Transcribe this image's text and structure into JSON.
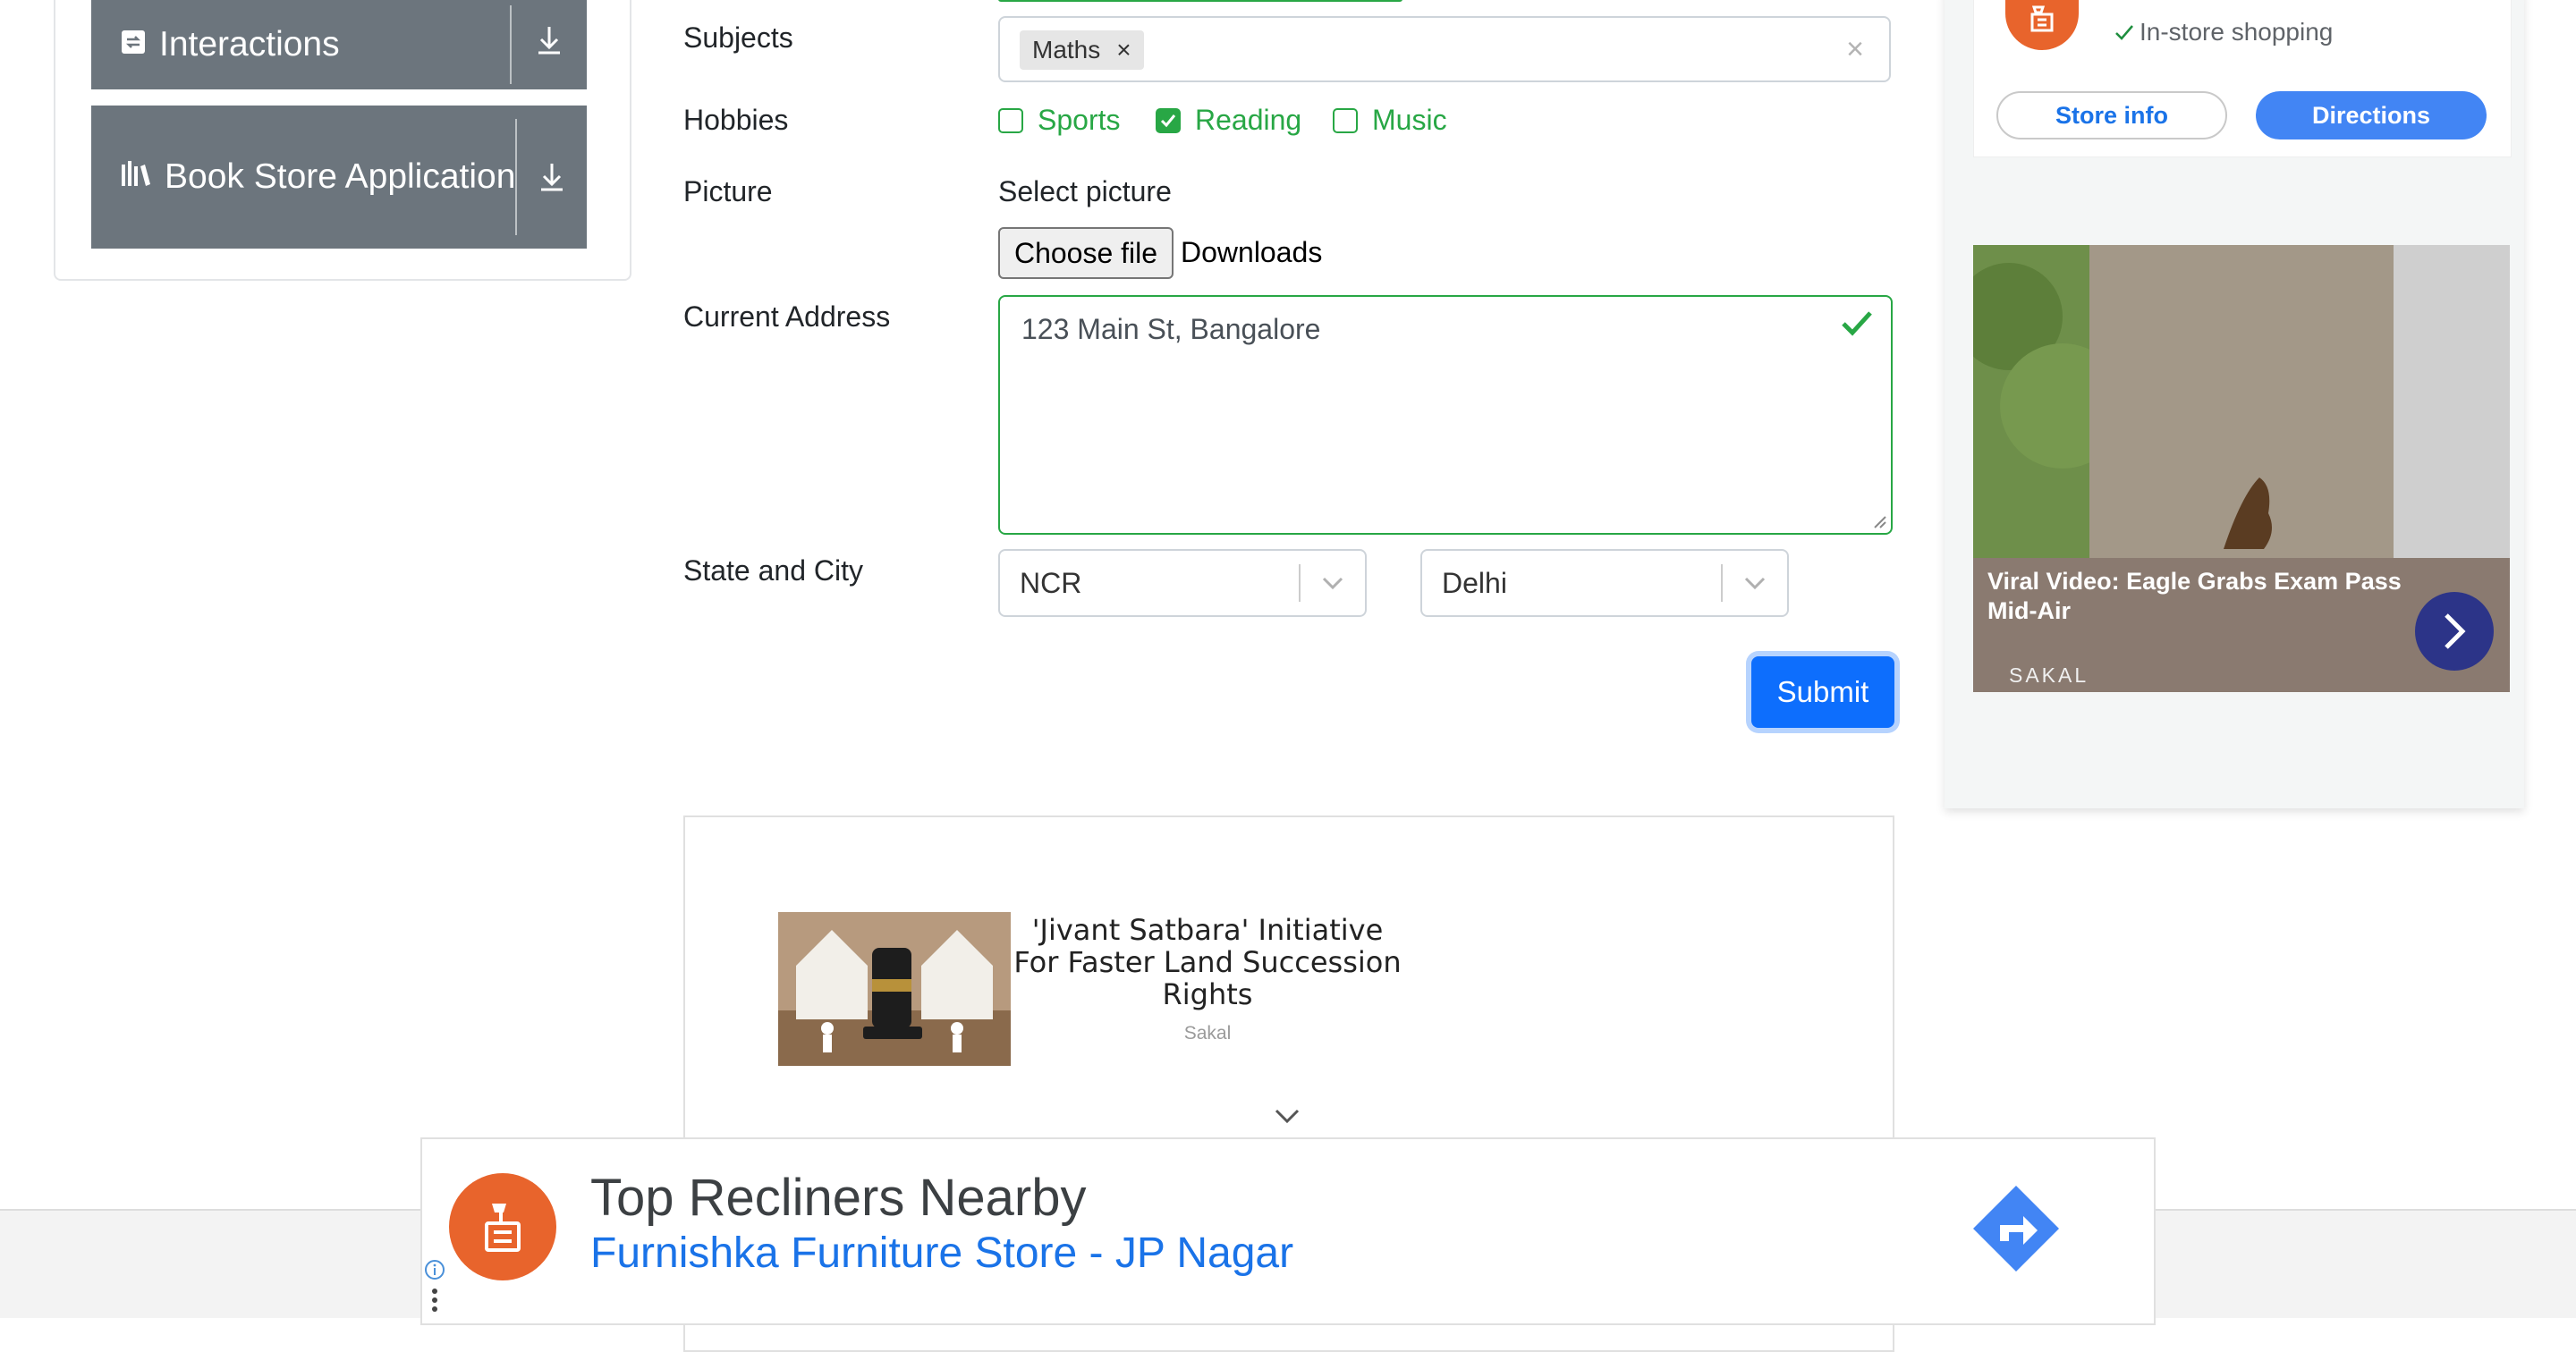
{
  "sidebar": {
    "items": [
      {
        "label": "Interactions"
      },
      {
        "label": "Book Store Application"
      }
    ]
  },
  "form": {
    "subjects_label": "Subjects",
    "subject_chip": "Maths",
    "chip_remove": "×",
    "clear_all": "×",
    "hobbies_label": "Hobbies",
    "hobbies": [
      {
        "label": "Sports",
        "checked": false
      },
      {
        "label": "Reading",
        "checked": true
      },
      {
        "label": "Music",
        "checked": false
      }
    ],
    "picture_label": "Picture",
    "select_picture": "Select picture",
    "choose_file": "Choose file",
    "file_name": "Downloads",
    "address_label": "Current Address",
    "address_value": "123 Main St, Bangalore",
    "state_city_label": "State and City",
    "state": "NCR",
    "city": "Delhi",
    "submit": "Submit"
  },
  "news": {
    "title": "'Jivant Satbara' Initiative For Faster Land Succession Rights",
    "source": "Sakal"
  },
  "right_ad": {
    "store_feature": "In-store shopping",
    "store_info_btn": "Store info",
    "directions_btn": "Directions",
    "video_caption": "Viral Video: Eagle Grabs Exam Pass Mid-Air",
    "video_source": "SAKAL"
  },
  "bottom_ad": {
    "title": "Top Recliners Nearby",
    "subtitle": "Furnishka Furniture Store - JP Nagar"
  },
  "colors": {
    "success": "#28a745",
    "primary": "#0d6efd",
    "sidebar_bg": "#6c757d",
    "ad_orange": "#e8642c",
    "ad_blue": "#1a73e8"
  }
}
